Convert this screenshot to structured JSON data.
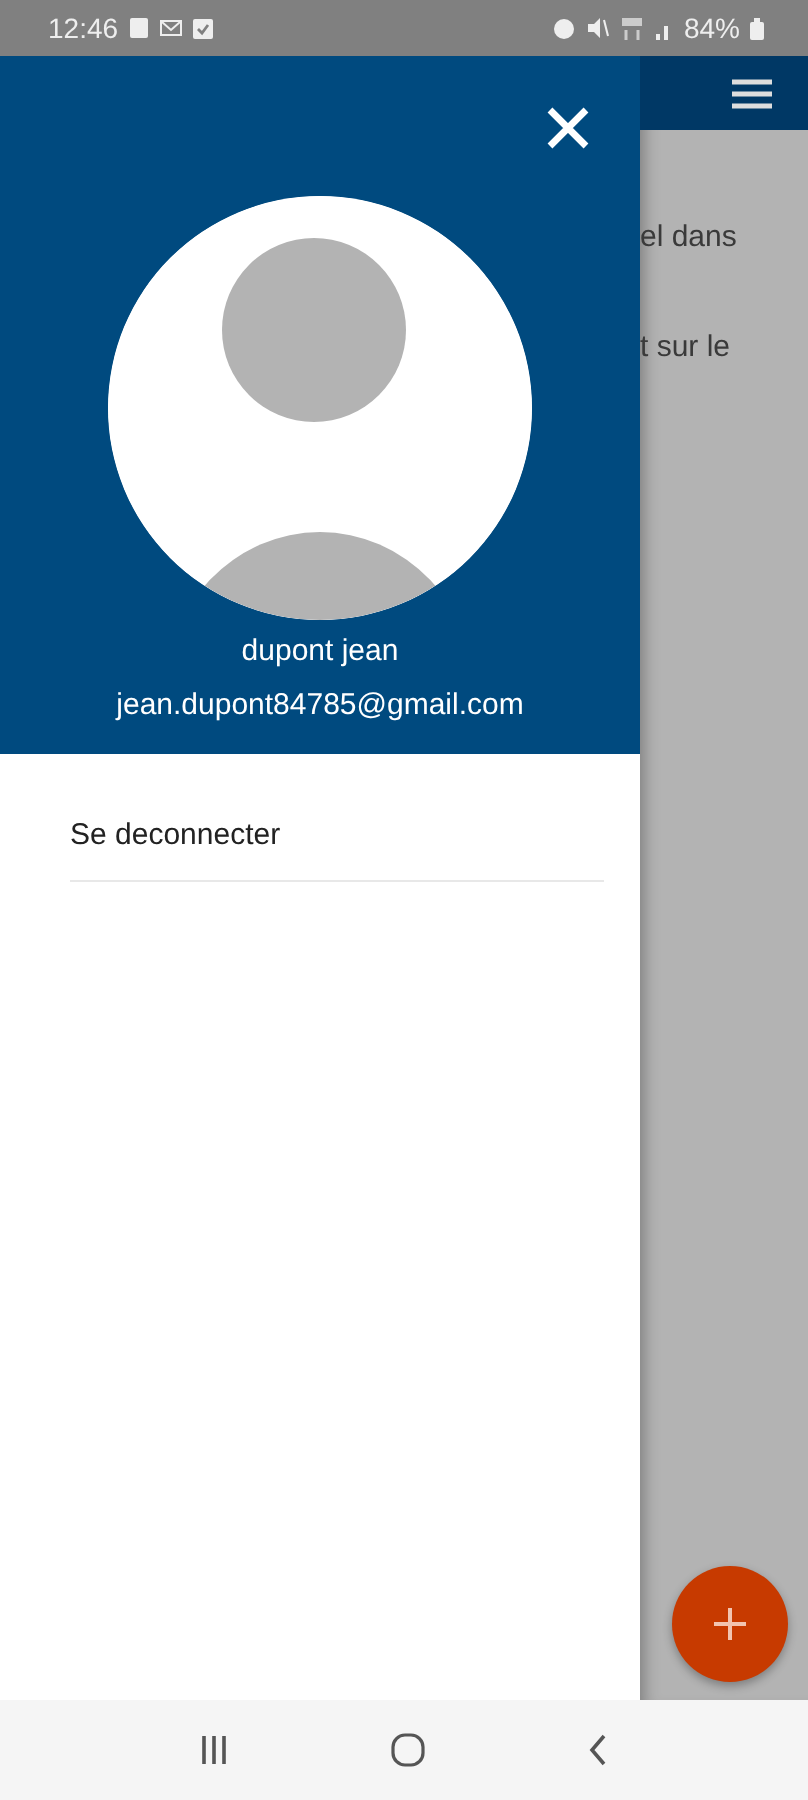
{
  "status_bar": {
    "time": "12:46",
    "battery": "84%"
  },
  "drawer": {
    "user_name": "dupont jean",
    "email": "jean.dupont84785@gmail.com",
    "menu_items": [
      {
        "label": "Se deconnecter"
      }
    ]
  },
  "background_page": {
    "text_lines": [
      "el dans",
      "t sur le"
    ]
  }
}
